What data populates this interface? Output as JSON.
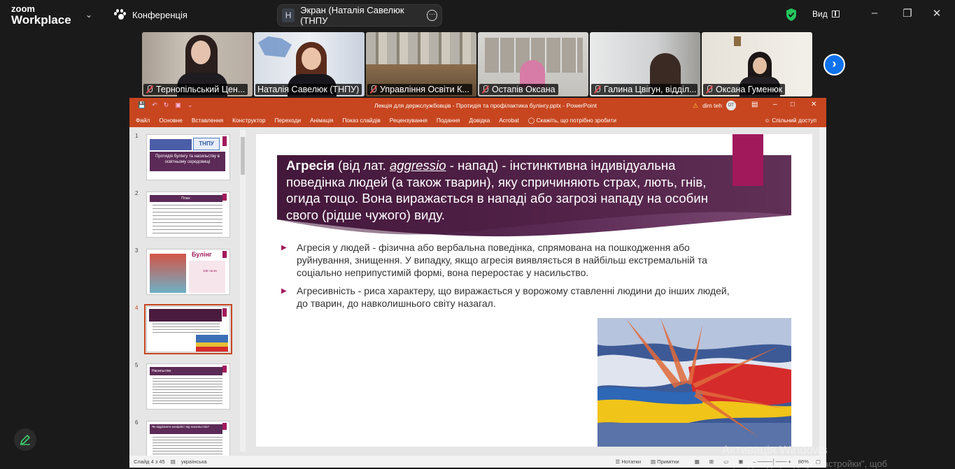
{
  "zoom": {
    "logo_line1": "zoom",
    "logo_line2": "Workplace",
    "meeting_label": "Конференція",
    "screen_share_avatar": "Н",
    "screen_share_label": "Экран (Наталія Савелюк (ТНПУ",
    "view_label": "Вид"
  },
  "participants": [
    {
      "name": "Тернопільський Цен...",
      "active": false
    },
    {
      "name": "Наталія Савелюк (ТНПУ)",
      "active": true
    },
    {
      "name": "Управління Освіти К...",
      "active": false
    },
    {
      "name": "Остапів Оксана",
      "active": false
    },
    {
      "name": "Галина Цвігун, відділ...",
      "active": false
    },
    {
      "name": "Оксана Гуменюк",
      "active": false
    }
  ],
  "ppt": {
    "title": "Лекція для держслужбовців - Протидія та профілактика булінгу.pptx  -  PowerPoint",
    "user": "dim teh",
    "user_initials": "DT",
    "menu": [
      "Файл",
      "Основне",
      "Вставлення",
      "Конструктор",
      "Переходи",
      "Анімація",
      "Показ слайдів",
      "Рецензування",
      "Подання",
      "Довідка",
      "Acrobat"
    ],
    "tell_me": "Скажіть, що потрібно зробити",
    "share": "Спільний доступ",
    "thumb_numbers": [
      "1",
      "2",
      "3",
      "4",
      "5",
      "6"
    ],
    "selected_slide": 4,
    "thumb1_title": "Протидія булінгу та насильству в освітньому середовищі",
    "thumb1_logo": "ТНПУ",
    "thumb2_title": "План:",
    "thumb3_title": "Булінг",
    "thumb3_stat": "108 тисяч",
    "thumb5_title": "Насильство",
    "thumb6_title": "Як відрізнити конфлікт від насильства?",
    "status": {
      "slide_of": "Слайд 4 з 45",
      "language": "українська",
      "notes": "Нотатки",
      "comments": "Примітки",
      "zoom": "86%"
    }
  },
  "slide": {
    "term": "Агресія",
    "def_part1": " (від лат. ",
    "latin": "aggressio",
    "def_part2": " - напад) - інстинктивна індивідуальна поведінка людей (а також тварин), яку спричиняють страх, лють, гнів, огида тощо. Вона виражається в нападі або загрозі нападу на особин свого (рідше чужого) виду.",
    "bullet1": "Агресія у людей - фізична або вербальна поведінка, спрямована на пошкодження або руйнування, знищення. У випадку, якщо агресія виявляється в найбільш екстремальній та соціально неприпустимій формі, вона переростає у насильство.",
    "bullet2": "Агресивність - риса характеру, що виражається у ворожому ставленні людини до інших людей, до тварин, до навколишнього світу назагал."
  },
  "watermark": {
    "line1": "Активація Windows",
    "line2": "Перейдіть до розділу \"Настройки\", щоб"
  },
  "colors": {
    "ppt_accent": "#c7461f",
    "slide_magenta": "#a2195b",
    "banner_purple": "#4a1b3f",
    "zoom_blue": "#0e72ed",
    "active_green": "#2ecc71"
  }
}
